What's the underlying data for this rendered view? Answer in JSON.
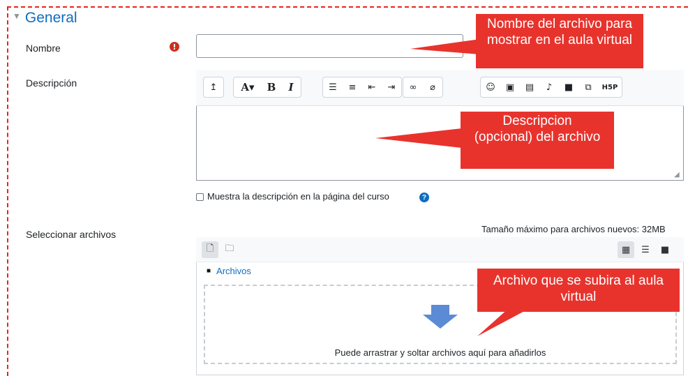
{
  "section": {
    "title": "General",
    "collapse_icon": "triangle-down-icon"
  },
  "fields": {
    "name_label": "Nombre",
    "required_icon": "!",
    "name_value": "",
    "description_label": "Descripción",
    "files_label": "Seleccionar archivos"
  },
  "editor": {
    "toolbar": [
      "↥",
      "A▾",
      "B",
      "I",
      "bullet-list-icon",
      "numbered-list-icon",
      "outdent-icon",
      "indent-icon",
      "link-icon",
      "unlink-icon",
      "emoji-icon",
      "image-icon",
      "media-icon",
      "record-audio-icon",
      "record-video-icon",
      "manage-files-icon",
      "h5p-icon"
    ],
    "h5p_label": "H5P",
    "text": ""
  },
  "show_description": {
    "label": "Muestra la descripción en la página del curso",
    "checked": false
  },
  "filepicker": {
    "max_size": "Tamaño máximo para archivos nuevos: 32MB",
    "breadcrumb": "Archivos",
    "drop_text": "Puede arrastrar y soltar archivos aquí para añadirlos"
  },
  "callouts": {
    "name": "Nombre del archivo para mostrar en el aula virtual",
    "description": "Descripcion (opcional) del archivo",
    "file": "Archivo que se subira al aula virtual"
  },
  "colors": {
    "callout": "#e8332d",
    "link": "#0f6cbf",
    "required": "#ca3120",
    "frame": "#e8231e"
  }
}
